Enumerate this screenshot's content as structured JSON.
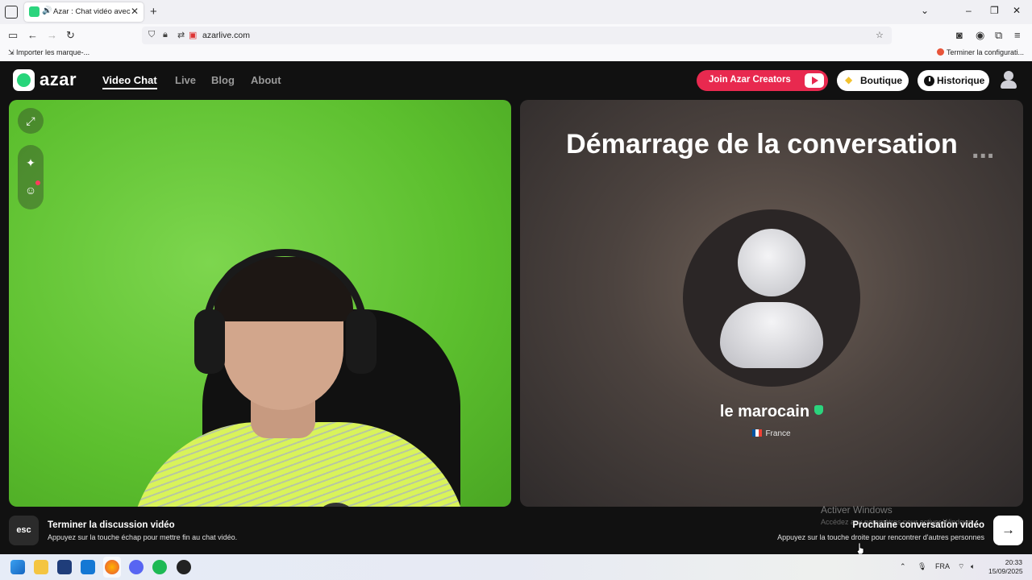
{
  "browser": {
    "tab_title": "Azar : Chat vidéo avec de n",
    "tab_speaker": "🔊",
    "url": "azarlive.com",
    "bookmark_left": "Importer les marque-...",
    "bookmark_right": "Terminer la configurati..."
  },
  "site": {
    "logo": "azar",
    "nav": [
      "Video Chat",
      "Live",
      "Blog",
      "About"
    ],
    "creators_button": "Join Azar Creators",
    "boutique_button": "Boutique",
    "historique_button": "Historique"
  },
  "peer": {
    "status_title": "Démarrage de la conversation",
    "status_dots": "...",
    "name": "le marocain",
    "country": "France"
  },
  "bottom": {
    "esc_key": "esc",
    "end_title": "Terminer la discussion vidéo",
    "end_sub": "Appuyez sur la touche échap pour mettre fin au chat vidéo.",
    "next_title": "Prochaine conversation vidéo",
    "next_sub": "Appuyez sur la touche droite pour rencontrer d'autres personnes",
    "next_arrow": "→"
  },
  "windows": {
    "activate_title": "Activer Windows",
    "activate_sub": "Accédez aux paramètres pour activer Windows.",
    "lang": "FRA",
    "time": "20:33",
    "date": "15/09/2025"
  },
  "colors": {
    "brand_green": "#27d57a",
    "creators_red": "#e8294f",
    "background": "#111111"
  }
}
